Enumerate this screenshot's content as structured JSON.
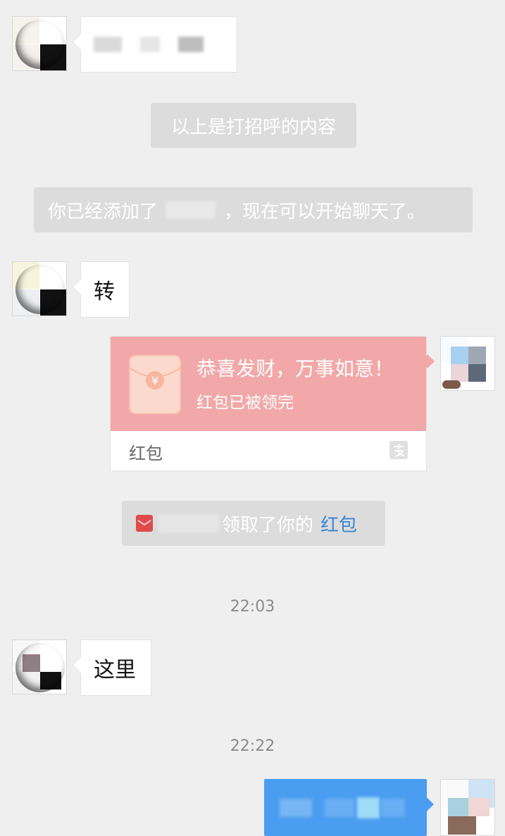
{
  "system": {
    "greeting_note": "以上是打招呼的内容",
    "added_prefix": "你已经添加了",
    "added_suffix": "，现在可以开始聊天了。",
    "claimed_text": "领取了你的",
    "claimed_link": "红包"
  },
  "messages": {
    "msg1": "",
    "msg2": "转",
    "msg3": "这里"
  },
  "red_packet": {
    "greeting": "恭喜发财，万事如意！",
    "status": "红包已被领完",
    "footer_label": "红包",
    "symbol": "¥"
  },
  "times": {
    "t1": "22:03",
    "t2": "22:22"
  },
  "colors": {
    "background": "#efeff0",
    "red_packet_top": "#f2a8a8",
    "outgoing_bubble": "#4a9df0",
    "link_blue": "#3a86d4"
  }
}
